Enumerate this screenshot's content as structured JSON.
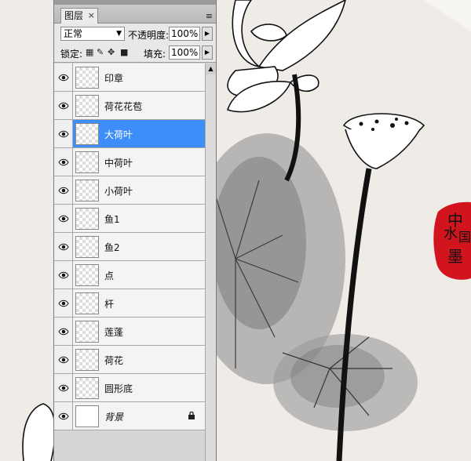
{
  "panel": {
    "tab_label": "图层",
    "tab_close": "×",
    "menu_icon": "≡",
    "blend_mode": "正常",
    "opacity_label": "不透明度:",
    "opacity_value": "100%",
    "lock_label": "锁定:",
    "fill_label": "填充:",
    "fill_value": "100%"
  },
  "layers": [
    {
      "name": "印章",
      "selected": false
    },
    {
      "name": "荷花花苞",
      "selected": false
    },
    {
      "name": "大荷叶",
      "selected": true
    },
    {
      "name": "中荷叶",
      "selected": false
    },
    {
      "name": "小荷叶",
      "selected": false
    },
    {
      "name": "鱼1",
      "selected": false
    },
    {
      "name": "鱼2",
      "selected": false
    },
    {
      "name": "点",
      "selected": false
    },
    {
      "name": "杆",
      "selected": false
    },
    {
      "name": "莲蓬",
      "selected": false
    },
    {
      "name": "荷花",
      "selected": false
    },
    {
      "name": "圆形底",
      "selected": false
    },
    {
      "name": "背景",
      "selected": false,
      "locked": true
    }
  ],
  "stamp": {
    "chars": [
      "中",
      "国",
      "水",
      "墨"
    ],
    "color": "#d1141d"
  },
  "colors": {
    "canvas_bg": "#efebe6",
    "selected_row": "#3d8ef8"
  }
}
